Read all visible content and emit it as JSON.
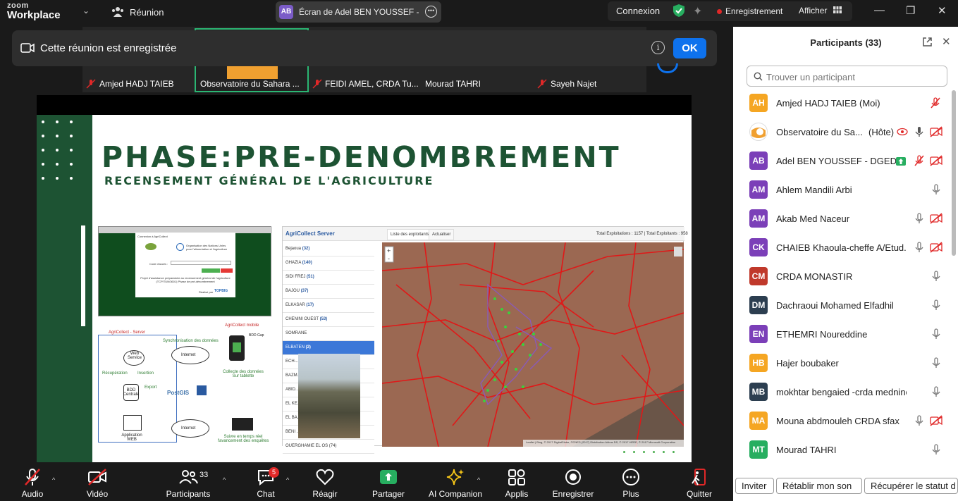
{
  "app": {
    "logo_line1": "zoom",
    "logo_line2": "Workplace",
    "meeting_label": "Réunion",
    "share_initials": "AB",
    "share_title": "Écran de Adel BEN YOUSSEF - DGEDA",
    "connexion": "Connexion",
    "recording": "Enregistrement",
    "afficher": "Afficher"
  },
  "banner": {
    "text": "Cette réunion est enregistrée",
    "ok": "OK"
  },
  "strip": {
    "names": [
      "Amjed HADJ TAIEB",
      "Observatoire du Sahara ...",
      "FEIDI AMEL, CRDA Tu...",
      "Mourad TAHRI",
      "Sayeh Najet"
    ]
  },
  "slide": {
    "title": "PHASE:PRE-DENOMBREMENT",
    "subtitle": "RECENSEMENT GÉNÉRAL DE L'AGRICULTURE",
    "login": {
      "header": "Connexion à AgriCollect",
      "org": "Organisation des Nations Unies pour l'alimentation et l'agriculture",
      "code_label": "Code d'accès :",
      "btn_ok": "Se connecter",
      "btn_cancel": "Annuler",
      "footer": "Projet d'assistance préparatoire au recensement général de l'agriculture (TCP/TUN/3601) Phase de pré-dénombrement",
      "realise": "Réalisé par",
      "brand": "TOPBIG"
    },
    "diagram": {
      "server": "AgriCollect - Server",
      "mobile": "AgriCollect mobile",
      "sync": "Synchronisation des données",
      "web_service": "Web Service",
      "internet": "Internet",
      "recup": "Récupération",
      "insertion": "Insertion",
      "export": "Export",
      "bdd": "BDD Centrale",
      "postgis": "PostGIS",
      "collecte": "Collecte des données Sur tablette",
      "app_web": "Application WEB",
      "suivi": "Suivre en temps réel l'avancement des enquêtes",
      "internet2": "Internet",
      "bdd_small": "BDD Gap"
    },
    "map": {
      "brand": "AgriCollect Server",
      "tab1": "Liste des exploitants",
      "tab2": "Actualiser",
      "total": "Total Exploitations : 1157 | Total Exploitants : 958",
      "list": [
        {
          "name": "Bejaoua",
          "count": "(32)"
        },
        {
          "name": "GHAZIA",
          "count": "(140)"
        },
        {
          "name": "SIDI FREJ",
          "count": "(51)"
        },
        {
          "name": "BAJOU",
          "count": "(37)"
        },
        {
          "name": "ELKASAR",
          "count": "(17)"
        },
        {
          "name": "CHENINI OUEST",
          "count": "(53)"
        },
        {
          "name": "SOMRANE",
          "count": ""
        },
        {
          "name": "ELBATEN",
          "count": "(2)"
        },
        {
          "name": "ECH-...",
          "count": ""
        },
        {
          "name": "BAZM...",
          "count": ""
        },
        {
          "name": "ABID...",
          "count": ""
        },
        {
          "name": "EL KE...",
          "count": ""
        },
        {
          "name": "EL BA...",
          "count": ""
        },
        {
          "name": "BENI ...",
          "count": ""
        },
        {
          "name": "OUERGHAMIE EL OS (74)",
          "count": ""
        }
      ],
      "attribution": "Leaflet | Bing, © 2017 DigitalGlobe, ©CNES (2017) Distribution Airbus DS, © 2017 HERE, © 2017 Microsoft Corporation"
    }
  },
  "toolbar": {
    "audio": "Audio",
    "video": "Vidéo",
    "participants": "Participants",
    "participants_count": "33",
    "chat": "Chat",
    "chat_badge": "5",
    "react": "Réagir",
    "share": "Partager",
    "ai": "AI Companion",
    "apps": "Applis",
    "record": "Enregistrer",
    "more": "Plus",
    "quit": "Quitter"
  },
  "panel": {
    "title": "Participants (33)",
    "search_placeholder": "Trouver un participant",
    "participants": [
      {
        "initials": "AH",
        "name": "Amjed HADJ TAIEB (Moi)",
        "color": "#f5a623",
        "extra": ""
      },
      {
        "initials": "",
        "name": "Observatoire du Sa...",
        "color": "#ffffff",
        "extra": "(Hôte)"
      },
      {
        "initials": "AB",
        "name": "Adel BEN YOUSSEF - DGEDA",
        "color": "#7b3fb8",
        "extra": ""
      },
      {
        "initials": "AM",
        "name": "Ahlem Mandili Arbi",
        "color": "#7b3fb8",
        "extra": ""
      },
      {
        "initials": "AM",
        "name": "Akab Med Naceur",
        "color": "#7b3fb8",
        "extra": ""
      },
      {
        "initials": "CK",
        "name": "CHAIEB Khaoula-cheffe A/Etud...",
        "color": "#7b3fb8",
        "extra": ""
      },
      {
        "initials": "CM",
        "name": "CRDA MONASTIR",
        "color": "#c0392b",
        "extra": ""
      },
      {
        "initials": "DM",
        "name": "Dachraoui Mohamed Elfadhil",
        "color": "#2c3e50",
        "extra": ""
      },
      {
        "initials": "EN",
        "name": "ETHEMRI Noureddine",
        "color": "#7b3fb8",
        "extra": ""
      },
      {
        "initials": "HB",
        "name": "Hajer boubaker",
        "color": "#f5a623",
        "extra": ""
      },
      {
        "initials": "MB",
        "name": "mokhtar bengaied -crda mednine",
        "color": "#2c3e50",
        "extra": ""
      },
      {
        "initials": "MA",
        "name": "Mouna abdmouleh CRDA sfax",
        "color": "#f5a623",
        "extra": ""
      },
      {
        "initials": "MT",
        "name": "Mourad TAHRI",
        "color": "#27ae60",
        "extra": ""
      }
    ],
    "btn_invite": "Inviter",
    "btn_reset": "Rétablir mon son",
    "btn_recover": "Récupérer le statut d"
  }
}
